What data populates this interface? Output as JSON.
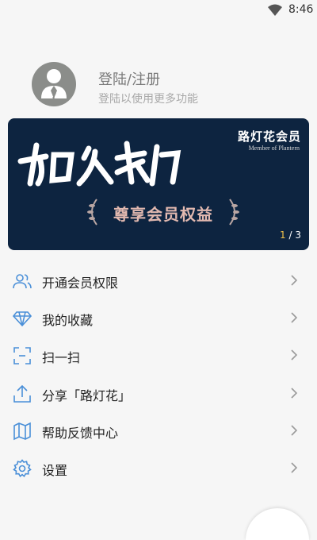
{
  "status": {
    "time": "8:46",
    "icons": [
      "wifi-icon"
    ]
  },
  "profile": {
    "name": "登陆/注册",
    "subtitle": "登陆以使用更多功能",
    "avatar_icon": "user-help-icon"
  },
  "banner": {
    "brand": "路灯花会员",
    "brand_en": "Member of Plantern",
    "slogan": "加入我们",
    "badge_text": "尊享会员权益",
    "page_current": "1",
    "page_total": " / 3",
    "colors": {
      "background": "#0d2440",
      "accent": "#e2b9b0"
    }
  },
  "menu": {
    "items": [
      {
        "label": "开通会员权限",
        "icon": "users-icon"
      },
      {
        "label": "我的收藏",
        "icon": "diamond-icon"
      },
      {
        "label": "扫一扫",
        "icon": "scan-icon"
      },
      {
        "label": "分享「路灯花」",
        "icon": "share-upload-icon"
      },
      {
        "label": "帮助反馈中心",
        "icon": "map-icon"
      },
      {
        "label": "设置",
        "icon": "gear-icon"
      }
    ]
  },
  "colors": {
    "icon_blue": "#4a8fd8"
  }
}
